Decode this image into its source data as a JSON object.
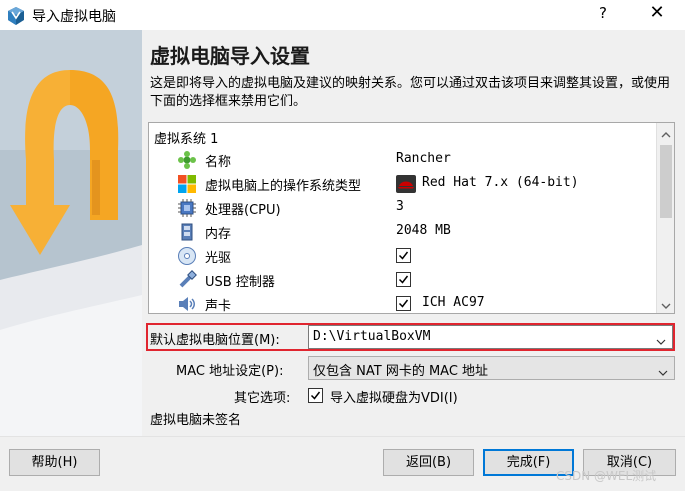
{
  "window": {
    "title": "导入虚拟电脑",
    "help_label": "?",
    "close_label": "✕"
  },
  "page": {
    "title": "虚拟电脑导入设置",
    "description": "这是即将导入的虚拟电脑及建议的映射关系。您可以通过双击该项目来调整其设置，或使用下面的选择框来禁用它们。"
  },
  "tree": {
    "header": "虚拟系统 1",
    "rows": [
      {
        "label": "名称",
        "value": "Rancher",
        "icon": "name-icon"
      },
      {
        "label": "虚拟电脑上的操作系统类型",
        "value": "Red Hat 7.x (64-bit)",
        "icon": "os-type-icon",
        "value_icon": "redhat-icon"
      },
      {
        "label": "处理器(CPU)",
        "value": "3",
        "icon": "cpu-icon"
      },
      {
        "label": "内存",
        "value": "2048 MB",
        "icon": "memory-icon"
      },
      {
        "label": "光驱",
        "checked": true,
        "icon": "optical-drive-icon"
      },
      {
        "label": "USB 控制器",
        "checked": true,
        "icon": "usb-icon"
      },
      {
        "label": "声卡",
        "checked": true,
        "value": "ICH AC97",
        "icon": "audio-icon"
      }
    ]
  },
  "settings": {
    "location_label": "默认虚拟电脑位置(M):",
    "location_value": "D:\\VirtualBoxVM",
    "mac_label": "MAC 地址设定(P):",
    "mac_value": "仅包含 NAT 网卡的 MAC 地址",
    "other_label": "其它选项:",
    "import_vdi_label": "导入虚拟硬盘为VDI(I)",
    "import_vdi_checked": true
  },
  "status": {
    "unsigned": "虚拟电脑未签名"
  },
  "buttons": {
    "help": "帮助(H)",
    "back": "返回(B)",
    "finish": "完成(F)",
    "cancel": "取消(C)"
  },
  "watermark": "CSDN @WEL测试",
  "colors": {
    "accent": "#0078d7",
    "highlight_border": "#e0252f",
    "arrow_orange": "#f5a623"
  }
}
